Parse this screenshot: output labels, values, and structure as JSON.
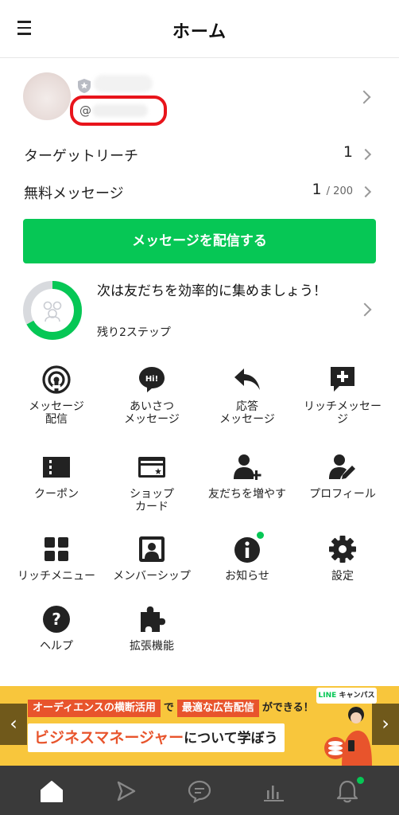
{
  "header": {
    "title": "ホーム",
    "menu_icon": "hamburger-menu-icon"
  },
  "profile": {
    "id_prefix": "@"
  },
  "stats": [
    {
      "label": "ターゲットリーチ",
      "value": "1",
      "sub": ""
    },
    {
      "label": "無料メッセージ",
      "value": "1",
      "sub": "/ 200"
    }
  ],
  "send_button": {
    "label": "メッセージを配信する"
  },
  "progress": {
    "title": "次は友だちを効率的に集めましょう！",
    "remaining": "残り2ステップ",
    "fraction": 0.67,
    "colors": {
      "fill": "#06c755",
      "track": "#d8dade"
    }
  },
  "menu": [
    {
      "name": "message-delivery",
      "label": "メッセージ\n配信",
      "icon": "broadcast-icon"
    },
    {
      "name": "greeting-message",
      "label": "あいさつ\nメッセージ",
      "icon": "hi-bubble-icon"
    },
    {
      "name": "auto-reply-message",
      "label": "応答\nメッセージ",
      "icon": "reply-arrow-icon"
    },
    {
      "name": "rich-message",
      "label": "リッチメッセー\nジ",
      "icon": "plus-bubble-icon"
    },
    {
      "name": "coupon",
      "label": "クーポン",
      "icon": "coupon-icon"
    },
    {
      "name": "shop-card",
      "label": "ショップ\nカード",
      "icon": "shop-card-icon"
    },
    {
      "name": "add-friends",
      "label": "友だちを増やす",
      "icon": "add-user-icon"
    },
    {
      "name": "profile",
      "label": "プロフィール",
      "icon": "edit-user-icon"
    },
    {
      "name": "rich-menu",
      "label": "リッチメニュー",
      "icon": "grid-icon"
    },
    {
      "name": "membership",
      "label": "メンバーシップ",
      "icon": "member-card-icon"
    },
    {
      "name": "notice",
      "label": "お知らせ",
      "icon": "info-icon"
    },
    {
      "name": "settings",
      "label": "設定",
      "icon": "gear-icon"
    },
    {
      "name": "help",
      "label": "ヘルプ",
      "icon": "help-icon"
    },
    {
      "name": "extensions",
      "label": "拡張機能",
      "icon": "puzzle-icon"
    }
  ],
  "banner": {
    "seg1": "オーディエンスの横断活用",
    "mid1": "で",
    "seg2": "最適な広告配信",
    "mid2": "ができる！",
    "main": "ビジネスマネージャー",
    "main_rest": "について学ぼう",
    "badge_line": "LINE",
    "badge_rest": "キャンパス",
    "prev": "‹",
    "next": "›"
  },
  "tabs": [
    {
      "name": "tab-home",
      "icon": "home-icon"
    },
    {
      "name": "tab-voom",
      "icon": "play-icon"
    },
    {
      "name": "tab-chat",
      "icon": "chat-icon"
    },
    {
      "name": "tab-analytics",
      "icon": "bar-chart-icon"
    },
    {
      "name": "tab-notifications",
      "icon": "bell-icon"
    }
  ],
  "colors": {
    "brand": "#06c755",
    "alert": "#e8141b",
    "banner": "#f8c63c",
    "tabbar": "#3a3a3a"
  }
}
